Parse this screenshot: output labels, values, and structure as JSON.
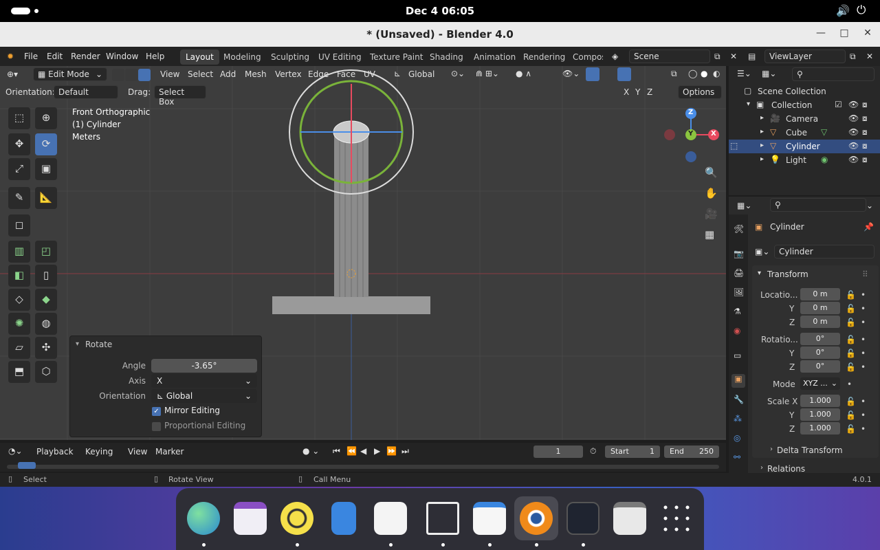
{
  "system": {
    "clock": "Dec 4  06:05"
  },
  "window": {
    "title": "* (Unsaved) - Blender 4.0"
  },
  "menu": {
    "items": [
      "File",
      "Edit",
      "Render",
      "Window",
      "Help"
    ]
  },
  "workspaces": [
    "Layout",
    "Modeling",
    "Sculpting",
    "UV Editing",
    "Texture Paint",
    "Shading",
    "Animation",
    "Rendering",
    "Compos"
  ],
  "scene": {
    "name": "Scene",
    "viewlayer": "ViewLayer"
  },
  "viewport_header": {
    "mode": "Edit Mode",
    "menus": [
      "View",
      "Select",
      "Add",
      "Mesh",
      "Vertex",
      "Edge",
      "Face",
      "UV"
    ],
    "transform_orientation": "Global",
    "orientation_label": "Orientation:",
    "orientation_value": "Default",
    "drag_label": "Drag:",
    "drag_value": "Select Box",
    "axes": [
      "X",
      "Y",
      "Z"
    ],
    "options": "Options"
  },
  "overlay_text": {
    "view": "Front Orthographic",
    "object": "(1) Cylinder",
    "units": "Meters"
  },
  "gizmo_axes": {
    "x": "X",
    "y": "Y",
    "z": "Z"
  },
  "operator_panel": {
    "title": "Rotate",
    "angle_label": "Angle",
    "angle_value": "-3.65°",
    "axis_label": "Axis",
    "axis_value": "X",
    "orientation_label": "Orientation",
    "orientation_value": "Global",
    "mirror_label": "Mirror Editing",
    "mirror_checked": true,
    "proportional_label": "Proportional Editing",
    "proportional_checked": false
  },
  "timeline": {
    "menus": [
      "Playback",
      "Keying",
      "View",
      "Marker"
    ],
    "current_frame": "1",
    "start_label": "Start",
    "start": "1",
    "end_label": "End",
    "end": "250"
  },
  "statusbar": {
    "select": "Select",
    "rotate": "Rotate View",
    "menu": "Call Menu",
    "version": "4.0.1"
  },
  "outliner": {
    "root": "Scene Collection",
    "collection": "Collection",
    "items": [
      "Camera",
      "Cube",
      "Cylinder",
      "Light"
    ]
  },
  "properties": {
    "object_name": "Cylinder",
    "datablock": "Cylinder",
    "transform_title": "Transform",
    "location_label": "Locatio...",
    "location": [
      "0 m",
      "0 m",
      "0 m"
    ],
    "rotation_label": "Rotatio...",
    "rotation": [
      "0°",
      "0°",
      "0°"
    ],
    "mode_label": "Mode",
    "mode_value": "XYZ ...",
    "scale_label": "Scale X",
    "scale": [
      "1.000",
      "1.000",
      "1.000"
    ],
    "y_label": "Y",
    "z_label": "Z",
    "delta": "Delta Transform",
    "relations": "Relations"
  },
  "colors": {
    "accent": "#4772b3",
    "x_axis": "#e84a5f",
    "y_axis": "#8bc53f",
    "z_axis": "#4a8ee8"
  }
}
